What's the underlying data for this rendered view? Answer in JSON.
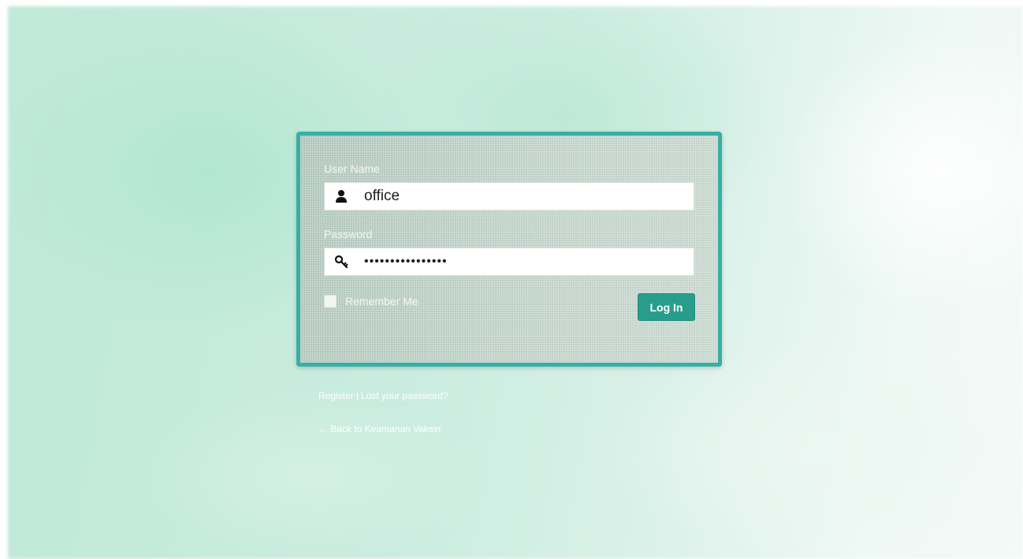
{
  "form": {
    "username_label": "User Name",
    "username_value": "office",
    "password_label": "Password",
    "password_value": "••••••••••••••••",
    "remember_label": "Remember Me",
    "remember_checked": false,
    "submit_label": "Log In"
  },
  "links": {
    "register": "Register",
    "separator": "|",
    "lost_password": "Lost your password?",
    "back_to_site": "← Back to Keamanan Vaksin"
  },
  "icons": {
    "username": "user-icon",
    "password": "key-icon"
  },
  "colors": {
    "accent": "#38afa4",
    "button": "#279e8d"
  }
}
